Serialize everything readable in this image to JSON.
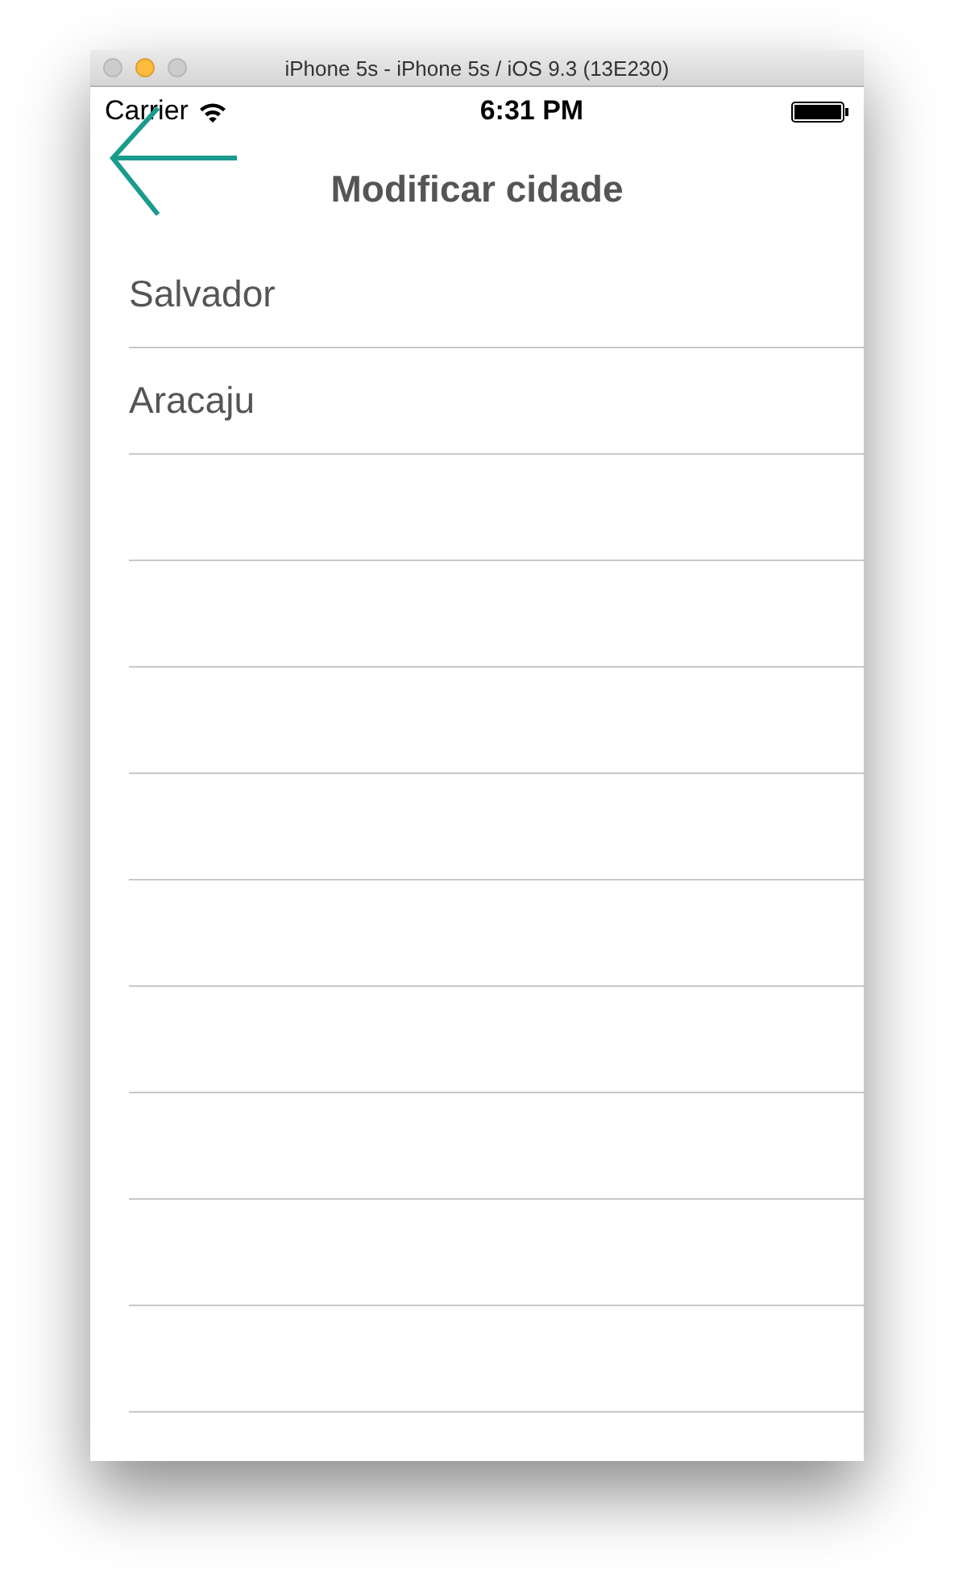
{
  "window": {
    "title": "iPhone 5s - iPhone 5s / iOS 9.3 (13E230)"
  },
  "status_bar": {
    "carrier": "Carrier",
    "time": "6:31 PM"
  },
  "nav_bar": {
    "title": "Modificar cidade"
  },
  "cities": [
    {
      "name": "Salvador"
    },
    {
      "name": "Aracaju"
    }
  ]
}
